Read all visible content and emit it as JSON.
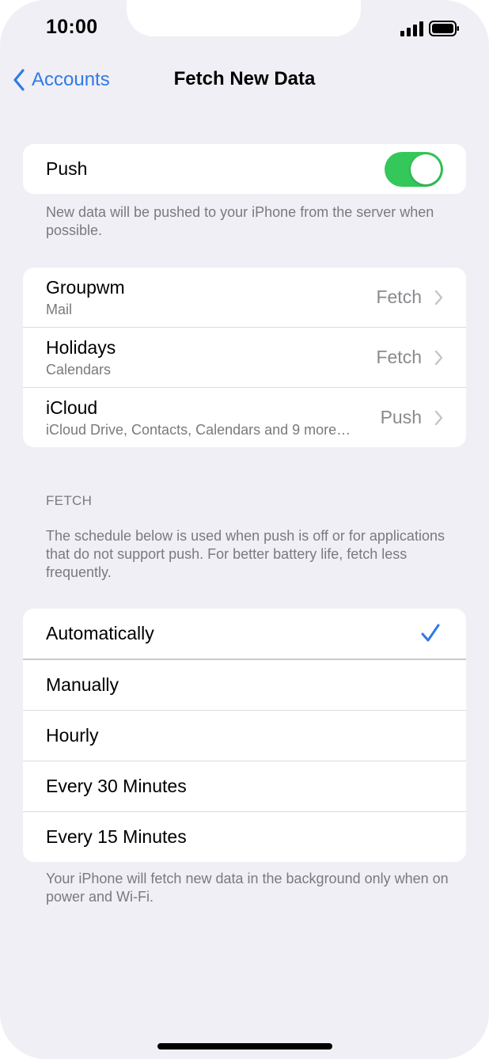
{
  "status_bar": {
    "time": "10:00",
    "icons": [
      "signal-icon",
      "battery-icon"
    ]
  },
  "nav": {
    "back_label": "Accounts",
    "title": "Fetch New Data"
  },
  "push": {
    "label": "Push",
    "enabled": true,
    "footnote": "New data will be pushed to your iPhone from the server when possible."
  },
  "accounts": [
    {
      "name": "Groupwm",
      "subtitle": "Mail",
      "value": "Fetch"
    },
    {
      "name": "Holidays",
      "subtitle": "Calendars",
      "value": "Fetch"
    },
    {
      "name": "iCloud",
      "subtitle": "iCloud Drive, Contacts, Calendars and 9 more…",
      "value": "Push"
    }
  ],
  "fetch": {
    "header": "FETCH",
    "description": "The schedule below is used when push is off or for applications that do not support push. For better battery life, fetch less frequently.",
    "options": [
      "Automatically",
      "Manually",
      "Hourly",
      "Every 30 Minutes",
      "Every 15 Minutes"
    ],
    "selected": "Automatically",
    "footnote": "Your iPhone will fetch new data in the background only when on power and Wi-Fi."
  },
  "colors": {
    "accent": "#2f7ae5",
    "toggle_on": "#34c759",
    "background": "#f0eff5"
  }
}
